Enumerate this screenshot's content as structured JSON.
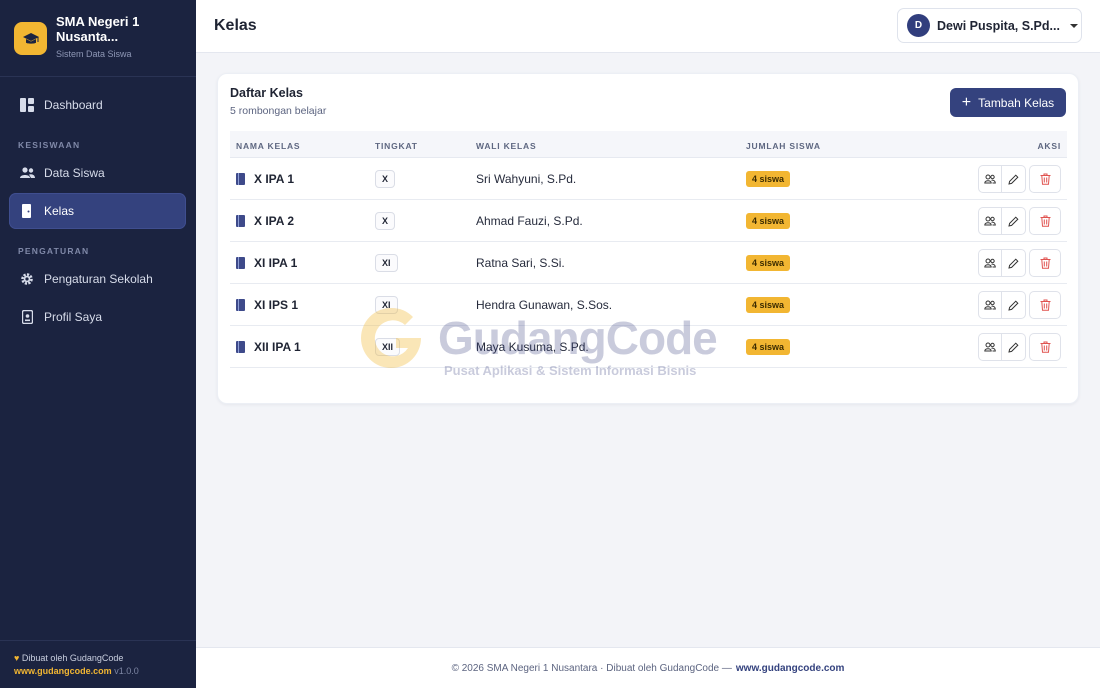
{
  "sidebar": {
    "brand_name": "SMA Negeri 1 Nusanta...",
    "brand_sub": "Sistem Data Siswa",
    "items": [
      {
        "label": "Dashboard"
      },
      {
        "label": "Data Siswa"
      },
      {
        "label": "Kelas"
      },
      {
        "label": "Pengaturan Sekolah"
      },
      {
        "label": "Profil Saya"
      }
    ],
    "sections": [
      "KESISWAAN",
      "PENGATURAN"
    ],
    "footer": {
      "credit": "Dibuat oleh GudangCode",
      "link": "www.gudangcode.com",
      "version": "v1.0.0"
    }
  },
  "header": {
    "title": "Kelas",
    "user_initial": "D",
    "user_name": "Dewi Puspita, S.Pd..."
  },
  "main": {
    "card_title": "Daftar Kelas",
    "card_sub": "5 rombongan belajar",
    "add_label": "Tambah Kelas",
    "columns": [
      "NAMA KELAS",
      "TINGKAT",
      "WALI KELAS",
      "JUMLAH SISWA",
      "AKSI"
    ],
    "rows": [
      {
        "name": "X IPA 1",
        "level": "X",
        "teacher": "Sri Wahyuni, S.Pd.",
        "count": "4 siswa"
      },
      {
        "name": "X IPA 2",
        "level": "X",
        "teacher": "Ahmad Fauzi, S.Pd.",
        "count": "4 siswa"
      },
      {
        "name": "XI IPA 1",
        "level": "XI",
        "teacher": "Ratna Sari, S.Si.",
        "count": "4 siswa"
      },
      {
        "name": "XI IPS 1",
        "level": "XI",
        "teacher": "Hendra Gunawan, S.Sos.",
        "count": "4 siswa"
      },
      {
        "name": "XII IPA 1",
        "level": "XII",
        "teacher": "Maya Kusuma, S.Pd.",
        "count": "4 siswa"
      }
    ]
  },
  "watermark": {
    "title": "GudangCode",
    "sub": "Pusat Aplikasi & Sistem Informasi Bisnis"
  },
  "footer": {
    "text": "© 2026 SMA Negeri 1 Nusantara · Dibuat oleh GudangCode —",
    "link": "www.gudangcode.com"
  },
  "colors": {
    "sidebar_bg": "#1b2340",
    "accent": "#34427e",
    "brand_yellow": "#f2b632",
    "delete_red": "#e0524f"
  }
}
